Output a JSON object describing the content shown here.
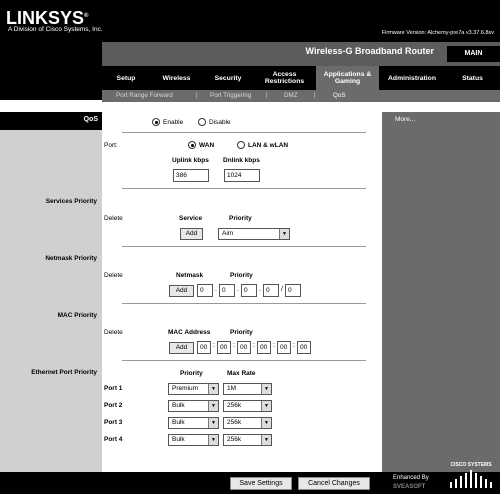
{
  "header": {
    "logo": "LINKSYS",
    "logo_mark": "®",
    "subtitle": "A Division of Cisco Systems, Inc.",
    "firmware": "Firmware Version: Alchemy-pre7a v3.37.6.8sv"
  },
  "title_bar": {
    "router_name": "Wireless-G Broadband Router",
    "model_tab": "MAIN"
  },
  "nav": {
    "tabs": [
      {
        "label": "Setup"
      },
      {
        "label": "Wireless"
      },
      {
        "label": "Security"
      },
      {
        "label": "Access Restrictions"
      },
      {
        "label": "Applications & Gaming"
      },
      {
        "label": "Administration"
      },
      {
        "label": "Status"
      }
    ],
    "subtabs": [
      {
        "label": "Port Range Forward"
      },
      {
        "label": "Port Triggering"
      },
      {
        "label": "DMZ"
      },
      {
        "label": "QoS"
      }
    ],
    "separator": "|"
  },
  "sidebar": {
    "qos": "QoS",
    "services_priority": "Services Priority",
    "netmask_priority": "Netmask Priority",
    "mac_priority": "MAC Priority",
    "ethernet_port_priority": "Ethernet Port Priority"
  },
  "right_panel": {
    "more": "More..."
  },
  "qos": {
    "enable_label": "Enable",
    "disable_label": "Disable",
    "selected": "Enable",
    "port_label": "Port:",
    "wan_label": "WAN",
    "lan_label": "LAN & wLAN",
    "port_selected": "WAN",
    "uplink_label": "Uplink kbps",
    "downlink_label": "Dnlink kbps",
    "uplink_value": "386",
    "downlink_value": "1024"
  },
  "services": {
    "delete_label": "Delete",
    "service_header": "Service",
    "priority_header": "Priority",
    "add_label": "Add",
    "service_value": "Aim"
  },
  "netmask": {
    "delete_label": "Delete",
    "netmask_header": "Netmask",
    "priority_header": "Priority",
    "add_label": "Add",
    "octets": [
      "0",
      "0",
      "0",
      "0"
    ],
    "mask": "0",
    "dot": ".",
    "slash": "/"
  },
  "mac": {
    "delete_label": "Delete",
    "mac_header": "MAC Address",
    "priority_header": "Priority",
    "add_label": "Add",
    "octets": [
      "00",
      "00",
      "00",
      "00",
      "00",
      "00"
    ],
    "colon": ":"
  },
  "ethernet": {
    "priority_header": "Priority",
    "maxrate_header": "Max Rate",
    "ports": [
      {
        "label": "Port 1",
        "priority": "Premium",
        "rate": "1M"
      },
      {
        "label": "Port 2",
        "priority": "Bulk",
        "rate": "256k"
      },
      {
        "label": "Port 3",
        "priority": "Bulk",
        "rate": "256k"
      },
      {
        "label": "Port 4",
        "priority": "Bulk",
        "rate": "256k"
      }
    ]
  },
  "footer": {
    "save_label": "Save Settings",
    "cancel_label": "Cancel Changes",
    "enhanced_by": "Enhanced By",
    "sveasoft": "SVEASOFT",
    "cisco": "CISCO SYSTEMS"
  },
  "icons": {
    "dropdown": "chevron-down-icon",
    "radio": "radio-icon",
    "cisco_logo": "cisco-bridge-icon"
  },
  "colors": {
    "header_bg": "#000000",
    "nav_active": "#6b6b6b",
    "sidebar_bg": "#d0d0d0",
    "right_panel_bg": "#6b6b6b"
  }
}
